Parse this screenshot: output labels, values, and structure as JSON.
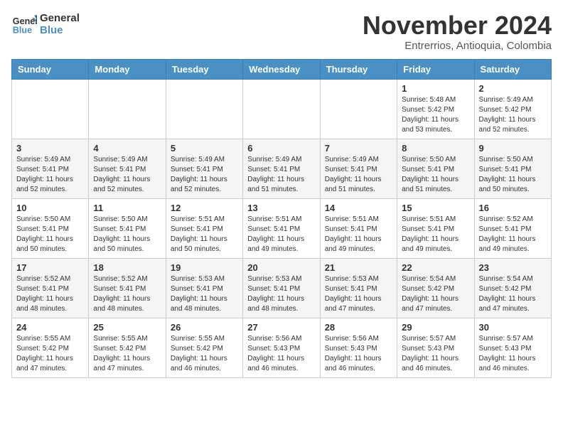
{
  "header": {
    "logo_line1": "General",
    "logo_line2": "Blue",
    "month": "November 2024",
    "location": "Entrerrios, Antioquia, Colombia"
  },
  "weekdays": [
    "Sunday",
    "Monday",
    "Tuesday",
    "Wednesday",
    "Thursday",
    "Friday",
    "Saturday"
  ],
  "weeks": [
    [
      {
        "day": "",
        "info": ""
      },
      {
        "day": "",
        "info": ""
      },
      {
        "day": "",
        "info": ""
      },
      {
        "day": "",
        "info": ""
      },
      {
        "day": "",
        "info": ""
      },
      {
        "day": "1",
        "info": "Sunrise: 5:48 AM\nSunset: 5:42 PM\nDaylight: 11 hours\nand 53 minutes."
      },
      {
        "day": "2",
        "info": "Sunrise: 5:49 AM\nSunset: 5:42 PM\nDaylight: 11 hours\nand 52 minutes."
      }
    ],
    [
      {
        "day": "3",
        "info": "Sunrise: 5:49 AM\nSunset: 5:41 PM\nDaylight: 11 hours\nand 52 minutes."
      },
      {
        "day": "4",
        "info": "Sunrise: 5:49 AM\nSunset: 5:41 PM\nDaylight: 11 hours\nand 52 minutes."
      },
      {
        "day": "5",
        "info": "Sunrise: 5:49 AM\nSunset: 5:41 PM\nDaylight: 11 hours\nand 52 minutes."
      },
      {
        "day": "6",
        "info": "Sunrise: 5:49 AM\nSunset: 5:41 PM\nDaylight: 11 hours\nand 51 minutes."
      },
      {
        "day": "7",
        "info": "Sunrise: 5:49 AM\nSunset: 5:41 PM\nDaylight: 11 hours\nand 51 minutes."
      },
      {
        "day": "8",
        "info": "Sunrise: 5:50 AM\nSunset: 5:41 PM\nDaylight: 11 hours\nand 51 minutes."
      },
      {
        "day": "9",
        "info": "Sunrise: 5:50 AM\nSunset: 5:41 PM\nDaylight: 11 hours\nand 50 minutes."
      }
    ],
    [
      {
        "day": "10",
        "info": "Sunrise: 5:50 AM\nSunset: 5:41 PM\nDaylight: 11 hours\nand 50 minutes."
      },
      {
        "day": "11",
        "info": "Sunrise: 5:50 AM\nSunset: 5:41 PM\nDaylight: 11 hours\nand 50 minutes."
      },
      {
        "day": "12",
        "info": "Sunrise: 5:51 AM\nSunset: 5:41 PM\nDaylight: 11 hours\nand 50 minutes."
      },
      {
        "day": "13",
        "info": "Sunrise: 5:51 AM\nSunset: 5:41 PM\nDaylight: 11 hours\nand 49 minutes."
      },
      {
        "day": "14",
        "info": "Sunrise: 5:51 AM\nSunset: 5:41 PM\nDaylight: 11 hours\nand 49 minutes."
      },
      {
        "day": "15",
        "info": "Sunrise: 5:51 AM\nSunset: 5:41 PM\nDaylight: 11 hours\nand 49 minutes."
      },
      {
        "day": "16",
        "info": "Sunrise: 5:52 AM\nSunset: 5:41 PM\nDaylight: 11 hours\nand 49 minutes."
      }
    ],
    [
      {
        "day": "17",
        "info": "Sunrise: 5:52 AM\nSunset: 5:41 PM\nDaylight: 11 hours\nand 48 minutes."
      },
      {
        "day": "18",
        "info": "Sunrise: 5:52 AM\nSunset: 5:41 PM\nDaylight: 11 hours\nand 48 minutes."
      },
      {
        "day": "19",
        "info": "Sunrise: 5:53 AM\nSunset: 5:41 PM\nDaylight: 11 hours\nand 48 minutes."
      },
      {
        "day": "20",
        "info": "Sunrise: 5:53 AM\nSunset: 5:41 PM\nDaylight: 11 hours\nand 48 minutes."
      },
      {
        "day": "21",
        "info": "Sunrise: 5:53 AM\nSunset: 5:41 PM\nDaylight: 11 hours\nand 47 minutes."
      },
      {
        "day": "22",
        "info": "Sunrise: 5:54 AM\nSunset: 5:42 PM\nDaylight: 11 hours\nand 47 minutes."
      },
      {
        "day": "23",
        "info": "Sunrise: 5:54 AM\nSunset: 5:42 PM\nDaylight: 11 hours\nand 47 minutes."
      }
    ],
    [
      {
        "day": "24",
        "info": "Sunrise: 5:55 AM\nSunset: 5:42 PM\nDaylight: 11 hours\nand 47 minutes."
      },
      {
        "day": "25",
        "info": "Sunrise: 5:55 AM\nSunset: 5:42 PM\nDaylight: 11 hours\nand 47 minutes."
      },
      {
        "day": "26",
        "info": "Sunrise: 5:55 AM\nSunset: 5:42 PM\nDaylight: 11 hours\nand 46 minutes."
      },
      {
        "day": "27",
        "info": "Sunrise: 5:56 AM\nSunset: 5:43 PM\nDaylight: 11 hours\nand 46 minutes."
      },
      {
        "day": "28",
        "info": "Sunrise: 5:56 AM\nSunset: 5:43 PM\nDaylight: 11 hours\nand 46 minutes."
      },
      {
        "day": "29",
        "info": "Sunrise: 5:57 AM\nSunset: 5:43 PM\nDaylight: 11 hours\nand 46 minutes."
      },
      {
        "day": "30",
        "info": "Sunrise: 5:57 AM\nSunset: 5:43 PM\nDaylight: 11 hours\nand 46 minutes."
      }
    ]
  ]
}
